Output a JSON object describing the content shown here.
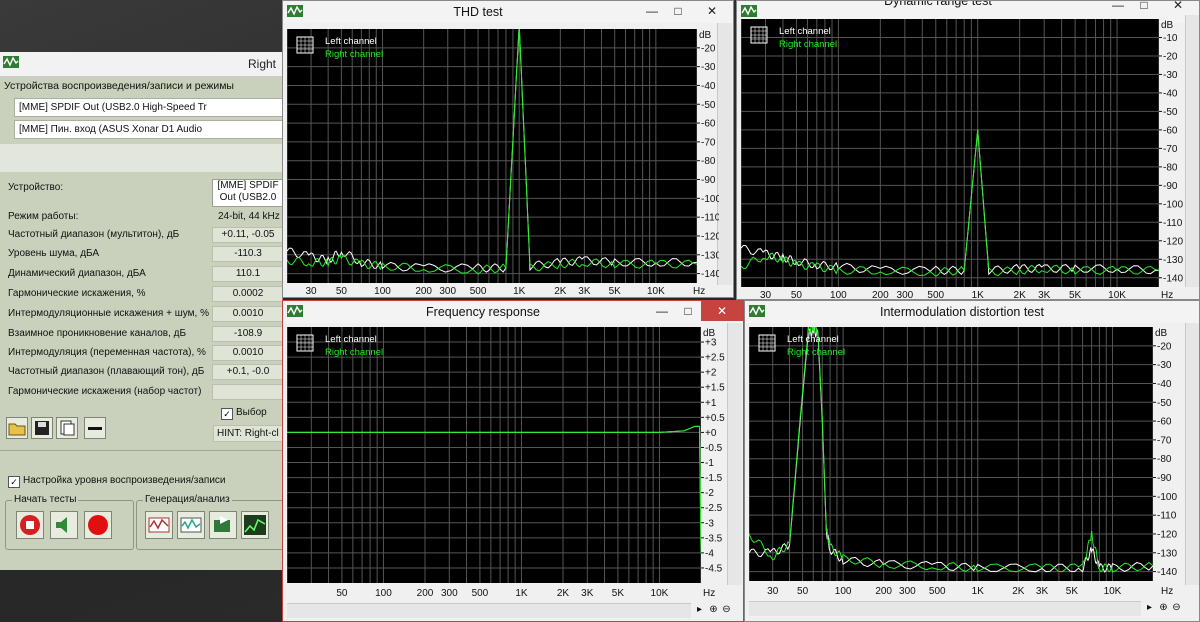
{
  "main_window": {
    "title": "Right",
    "devices_group_label": "Устройства воспроизведения/записи и режимы",
    "playback_device": "[MME] SPDIF Out (USB2.0 High-Speed Tr",
    "record_device": "[MME] Пин. вход (ASUS Xonar D1 Audio",
    "device_label": "Устройство:",
    "device_value_line1": "[MME] SPDIF",
    "device_value_line2": "Out (USB2.0",
    "mode_label": "Режим работы:",
    "mode_value": "24-bit, 44 kHz",
    "params": [
      {
        "label": "Частотный диапазон (мультитон), дБ",
        "value": "+0.11, -0.05"
      },
      {
        "label": "Уровень шума, дБА",
        "value": "-110.3"
      },
      {
        "label": "Динамический диапазон, дБА",
        "value": "110.1"
      },
      {
        "label": "Гармонические искажения, %",
        "value": "0.0002"
      },
      {
        "label": "Интермодуляционные искажения + шум, %",
        "value": "0.0010"
      },
      {
        "label": "Взаимное проникновение каналов, дБ",
        "value": "-108.9"
      },
      {
        "label": "Интермодуляция (переменная частота), %",
        "value": "0.0010"
      },
      {
        "label": "Частотный диапазон (плавающий тон), дБ",
        "value": "+0.1, -0.0"
      },
      {
        "label": "Гармонические искажения (набор частот)",
        "value": ""
      }
    ],
    "select_label": "Выбор",
    "hint_text": "HINT: Right-cl",
    "level_setup_label": "Настройка уровня воспроизведения/записи",
    "start_tests_label": "Начать тесты",
    "gen_analysis_label": "Генерация/анализ"
  },
  "legend": {
    "left": "Left channel",
    "right": "Right channel"
  },
  "colors": {
    "left": "#ffffff",
    "right": "#22ee22",
    "grid": "#555555",
    "plot_bg": "#000000",
    "panel": "#c9d1bc"
  },
  "icons": [
    "app-logo-icon",
    "open-folder-icon",
    "save-disk-icon",
    "copy-report-icon",
    "dash-icon",
    "record-stop-icon",
    "speaker-icon",
    "red-circle-icon",
    "analyzer-icon",
    "zoom-in-icon",
    "zoom-out-icon"
  ],
  "windows": {
    "thd": {
      "title": "THD test"
    },
    "dynamic": {
      "title": "Dynamic range test"
    },
    "freq": {
      "title": "Frequency response"
    },
    "imd": {
      "title": "Intermodulation distortion test"
    }
  },
  "axis": {
    "x_unit": "Hz",
    "y_unit": "dB",
    "x_ticks_thd": [
      "30",
      "50",
      "100",
      "200",
      "300",
      "500",
      "1K",
      "2K",
      "3K",
      "5K",
      "10K"
    ],
    "x_ticks_freq": [
      "50",
      "100",
      "200",
      "300",
      "500",
      "1K",
      "2K",
      "3K",
      "5K",
      "10K"
    ],
    "y_ticks_thd": [
      "-20",
      "-30",
      "-40",
      "-50",
      "-60",
      "-70",
      "-80",
      "-90",
      "-100",
      "-110",
      "-120",
      "-130",
      "-140"
    ],
    "y_ticks_dyn": [
      "-10",
      "-20",
      "-30",
      "-40",
      "-50",
      "-60",
      "-70",
      "-80",
      "-90",
      "-100",
      "-110",
      "-120",
      "-130",
      "-140"
    ],
    "y_ticks_imd": [
      "-20",
      "-30",
      "-40",
      "-50",
      "-60",
      "-70",
      "-80",
      "-90",
      "-100",
      "-110",
      "-120",
      "-130",
      "-140"
    ],
    "y_ticks_freq": [
      "+3",
      "+2.5",
      "+2",
      "+1.5",
      "+1",
      "+0.5",
      "+0",
      "-0.5",
      "-1",
      "-1.5",
      "-2",
      "-2.5",
      "-3",
      "-3.5",
      "-4",
      "-4.5"
    ]
  },
  "chart_data": [
    {
      "type": "line",
      "title": "THD test",
      "xlabel": "Hz",
      "ylabel": "dB",
      "x_scale": "log",
      "xlim": [
        20,
        20000
      ],
      "ylim": [
        -145,
        -10
      ],
      "series": [
        {
          "name": "Left channel",
          "x": [
            20,
            30,
            40,
            50,
            70,
            100,
            200,
            500,
            800,
            1000,
            1200,
            2000,
            3000,
            5000,
            10000,
            20000
          ],
          "y": [
            -128,
            -131,
            -133,
            -128,
            -134,
            -136,
            -137,
            -137,
            -137,
            -8,
            -136,
            -134,
            -133,
            -134,
            -134,
            -134
          ]
        },
        {
          "name": "Right channel",
          "x": [
            20,
            30,
            40,
            50,
            70,
            100,
            200,
            500,
            800,
            1000,
            1200,
            2000,
            3000,
            5000,
            10000,
            20000
          ],
          "y": [
            -133,
            -134,
            -134,
            -132,
            -135,
            -136,
            -137,
            -138,
            -137,
            -8,
            -137,
            -135,
            -134,
            -135,
            -135,
            -135
          ]
        }
      ]
    },
    {
      "type": "line",
      "title": "Dynamic range test",
      "xlabel": "Hz",
      "ylabel": "dB",
      "x_scale": "log",
      "xlim": [
        20,
        20000
      ],
      "ylim": [
        -145,
        0
      ],
      "series": [
        {
          "name": "Left channel",
          "x": [
            20,
            30,
            40,
            50,
            70,
            100,
            200,
            500,
            800,
            1000,
            1200,
            2000,
            3000,
            5000,
            10000,
            20000
          ],
          "y": [
            -124,
            -127,
            -129,
            -131,
            -133,
            -134,
            -136,
            -136,
            -136,
            -60,
            -136,
            -135,
            -135,
            -135,
            -135,
            -136
          ]
        },
        {
          "name": "Right channel",
          "x": [
            20,
            30,
            40,
            50,
            70,
            100,
            200,
            500,
            800,
            1000,
            1200,
            2000,
            3000,
            5000,
            10000,
            20000
          ],
          "y": [
            -134,
            -128,
            -130,
            -133,
            -134,
            -136,
            -136,
            -137,
            -136,
            -60,
            -137,
            -136,
            -135,
            -136,
            -136,
            -136
          ]
        }
      ]
    },
    {
      "type": "line",
      "title": "Frequency response",
      "xlabel": "Hz",
      "ylabel": "dB",
      "x_scale": "log",
      "xlim": [
        20,
        20000
      ],
      "ylim": [
        -5,
        3.5
      ],
      "series": [
        {
          "name": "Left channel",
          "x": [
            20,
            100,
            1000,
            5000,
            10000,
            15000,
            18000,
            19500,
            20000
          ],
          "y": [
            0,
            0,
            0,
            0,
            0,
            0.05,
            0.2,
            0.2,
            -4
          ]
        },
        {
          "name": "Right channel",
          "x": [
            20,
            100,
            1000,
            5000,
            10000,
            15000,
            18000,
            19500,
            20000
          ],
          "y": [
            0,
            0,
            0,
            0,
            0,
            0.05,
            0.2,
            0.2,
            -4
          ]
        }
      ]
    },
    {
      "type": "line",
      "title": "Intermodulation distortion test",
      "xlabel": "Hz",
      "ylabel": "dB",
      "x_scale": "log",
      "xlim": [
        20,
        20000
      ],
      "ylim": [
        -145,
        -10
      ],
      "series": [
        {
          "name": "Left channel",
          "x": [
            20,
            30,
            40,
            48,
            55,
            60,
            65,
            70,
            75,
            80,
            100,
            200,
            500,
            1000,
            3000,
            6000,
            7000,
            8000,
            10000,
            20000
          ],
          "y": [
            -130,
            -130,
            -126,
            -60,
            -14,
            -12,
            -14,
            -60,
            -118,
            -128,
            -134,
            -136,
            -137,
            -138,
            -138,
            -138,
            -128,
            -138,
            -138,
            -137
          ]
        },
        {
          "name": "Right channel",
          "x": [
            20,
            30,
            40,
            48,
            55,
            60,
            65,
            70,
            75,
            80,
            100,
            200,
            500,
            1000,
            3000,
            6000,
            7000,
            8000,
            10000,
            20000
          ],
          "y": [
            -120,
            -132,
            -125,
            -58,
            -12,
            -10,
            -12,
            -58,
            -118,
            -127,
            -133,
            -136,
            -137,
            -138,
            -138,
            -138,
            -120,
            -138,
            -138,
            -137
          ]
        }
      ]
    }
  ]
}
